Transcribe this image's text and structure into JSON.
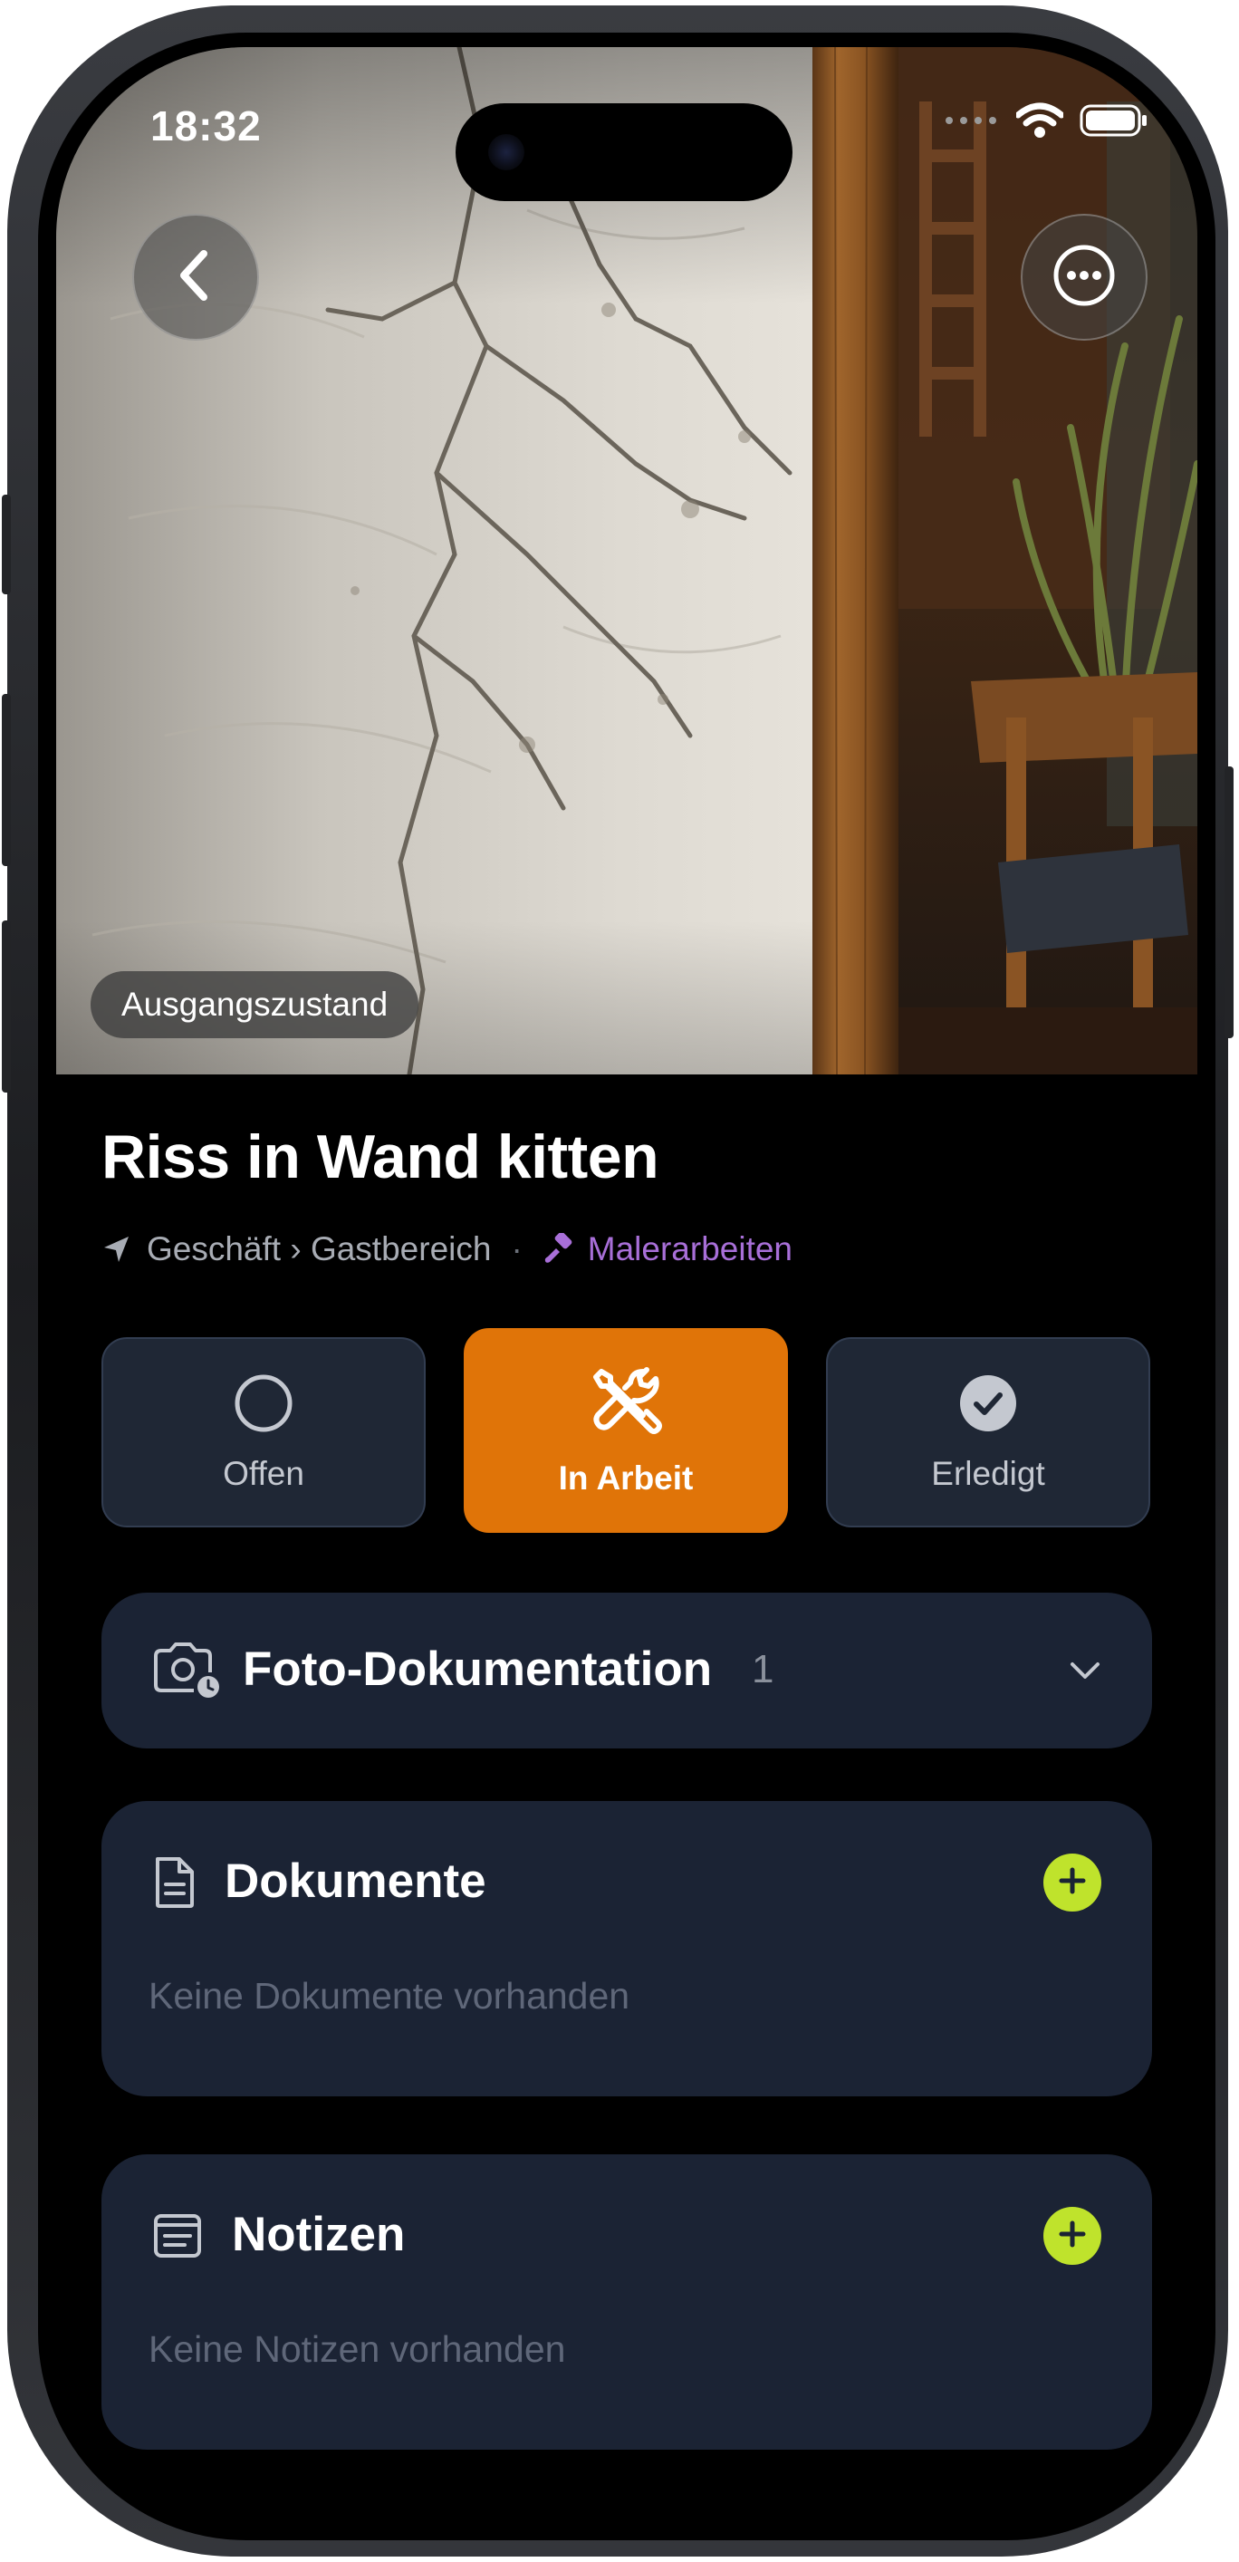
{
  "status_bar": {
    "time": "18:32",
    "icons": [
      "cellular-icon",
      "wifi-icon",
      "battery-icon"
    ]
  },
  "hero": {
    "badge": "Ausgangszustand",
    "back_icon": "chevron-left-icon",
    "more_icon": "ellipsis-circle-icon"
  },
  "task": {
    "title": "Riss in Wand kitten",
    "location": "Geschäft › Gastbereich",
    "separator": "·",
    "trade": "Malerarbeiten",
    "trade_color": "#a86fd8"
  },
  "status_options": [
    {
      "label": "Offen",
      "icon": "circle-icon",
      "selected": false
    },
    {
      "label": "In Arbeit",
      "icon": "tools-icon",
      "selected": true
    },
    {
      "label": "Erledigt",
      "icon": "checkmark-circle-icon",
      "selected": false
    }
  ],
  "sections": {
    "photos": {
      "title": "Foto-Dokumentation",
      "count": "1",
      "icon": "camera-icon",
      "toggle_icon": "chevron-down-icon"
    },
    "documents": {
      "title": "Dokumente",
      "empty": "Keine Dokumente vorhanden",
      "icon": "document-icon",
      "add_icon": "plus-icon"
    },
    "notes": {
      "title": "Notizen",
      "empty": "Keine Notizen vorhanden",
      "icon": "note-icon",
      "add_icon": "plus-icon"
    }
  },
  "colors": {
    "background": "#000000",
    "card": "#1b2334",
    "accent_orange": "#e07408",
    "accent_lime": "#bfe32c",
    "muted_text": "#5f6779"
  }
}
